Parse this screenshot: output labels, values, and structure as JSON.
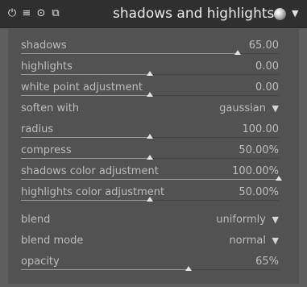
{
  "header": {
    "title": "shadows and highlights",
    "icons": [
      "power-icon",
      "presets-icon",
      "reset-icon",
      "multi-instance-icon"
    ]
  },
  "sliders": [
    {
      "label": "shadows",
      "value": "65.00",
      "level": 0.84
    },
    {
      "label": "highlights",
      "value": "0.00",
      "level": 0.5
    },
    {
      "label": "white point adjustment",
      "value": "0.00",
      "level": 0.5
    },
    {
      "label": "radius",
      "value": "100.00",
      "level": 0.5
    },
    {
      "label": "compress",
      "value": "50.00%",
      "level": 0.5
    },
    {
      "label": "shadows color adjustment",
      "value": "100.00%",
      "level": 1.0
    },
    {
      "label": "highlights color adjustment",
      "value": "50.00%",
      "level": 0.5
    },
    {
      "label": "opacity",
      "value": "65%",
      "level": 0.65
    }
  ],
  "combos": {
    "soften_with": {
      "label": "soften with",
      "value": "gaussian"
    },
    "blend": {
      "label": "blend",
      "value": "uniformly"
    },
    "blend_mode": {
      "label": "blend mode",
      "value": "normal"
    }
  },
  "colors": {
    "header_bg": "#2f2f2f",
    "panel_bg": "#525252",
    "text": "#bdbdbd",
    "marker": "#e4e4e4"
  }
}
